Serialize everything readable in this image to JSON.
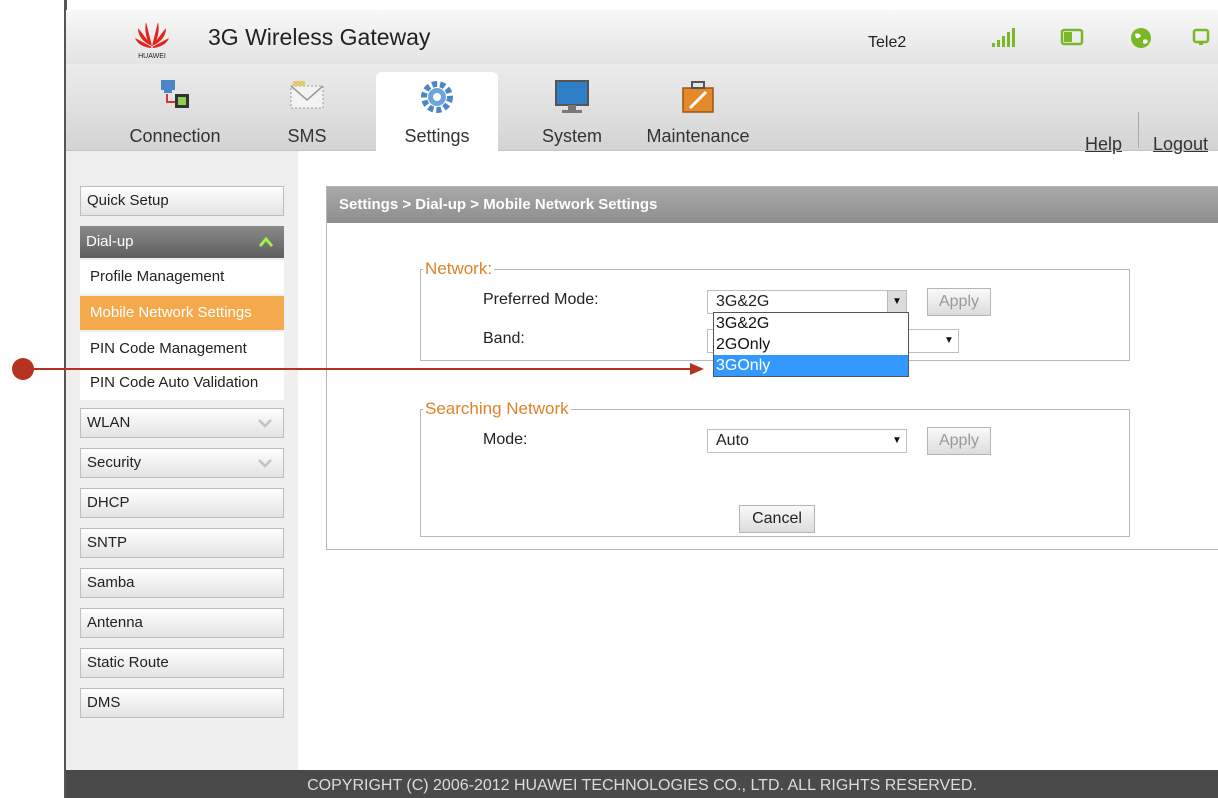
{
  "header": {
    "brand": "HUAWEI",
    "title": "3G Wireless Gateway",
    "operator": "Tele2",
    "status_icons": [
      "signal-strength-icon",
      "sim-card-icon",
      "internet-globe-icon",
      "network-device-icon"
    ],
    "colors": {
      "status_green": "#7ab828",
      "brand_red": "#e3231d"
    }
  },
  "nav": {
    "tabs": [
      {
        "label": "Connection",
        "icon": "connection-icon"
      },
      {
        "label": "SMS",
        "icon": "envelope-icon"
      },
      {
        "label": "Settings",
        "icon": "gear-icon",
        "active": true
      },
      {
        "label": "System",
        "icon": "monitor-icon"
      },
      {
        "label": "Maintenance",
        "icon": "toolbox-icon"
      }
    ],
    "help_label": "Help",
    "logout_label": "Logout"
  },
  "sidebar": {
    "quick_setup": "Quick Setup",
    "dialup": {
      "label": "Dial-up",
      "items": [
        "Profile Management",
        "Mobile Network Settings",
        "PIN Code Management",
        "PIN Code Auto Validation"
      ],
      "active_index": 1
    },
    "items": [
      "WLAN",
      "Security",
      "DHCP",
      "SNTP",
      "Samba",
      "Antenna",
      "Static Route",
      "DMS"
    ],
    "active_color": "#f5a94d"
  },
  "content": {
    "breadcrumb": "Settings > Dial-up > Mobile Network Settings",
    "network": {
      "legend": "Network:",
      "preferred_mode_label": "Preferred Mode:",
      "preferred_mode_value": "3G&2G",
      "apply_label": "Apply",
      "band_label": "Band:",
      "dropdown_options": [
        "3G&2G",
        "2GOnly",
        "3GOnly"
      ],
      "highlighted_option": "3GOnly"
    },
    "searching": {
      "legend": "Searching Network",
      "mode_label": "Mode:",
      "mode_value": "Auto",
      "apply_label": "Apply",
      "cancel_label": "Cancel"
    },
    "accent_color": "#e0822c"
  },
  "footer": {
    "copyright": "COPYRIGHT (C) 2006-2012 HUAWEI TECHNOLOGIES CO., LTD. ALL RIGHTS RESERVED."
  },
  "annotation": {
    "color": "#b5321e"
  }
}
